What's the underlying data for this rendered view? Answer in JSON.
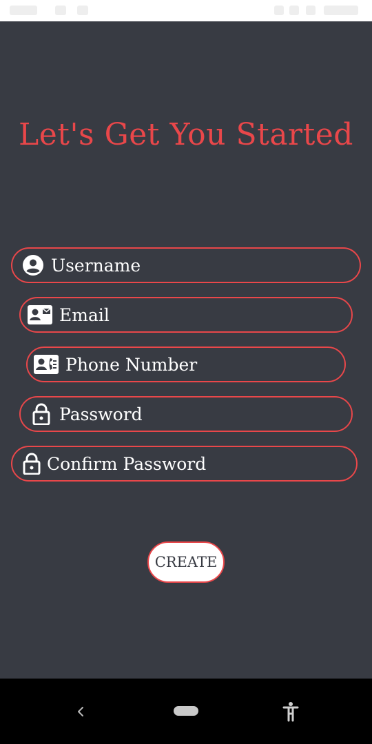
{
  "header": {
    "title": "Let's Get You Started"
  },
  "form": {
    "fields": [
      {
        "label": "Username",
        "icon": "account-circle-icon"
      },
      {
        "label": "Email",
        "icon": "contact-mail-icon"
      },
      {
        "label": "Phone Number",
        "icon": "contact-phone-icon"
      },
      {
        "label": "Password",
        "icon": "lock-icon"
      },
      {
        "label": "Confirm Password",
        "icon": "lock-icon"
      }
    ],
    "submit_label": "CREATE"
  },
  "colors": {
    "background": "#383b43",
    "accent": "#e9474a",
    "text": "#ffffff"
  }
}
